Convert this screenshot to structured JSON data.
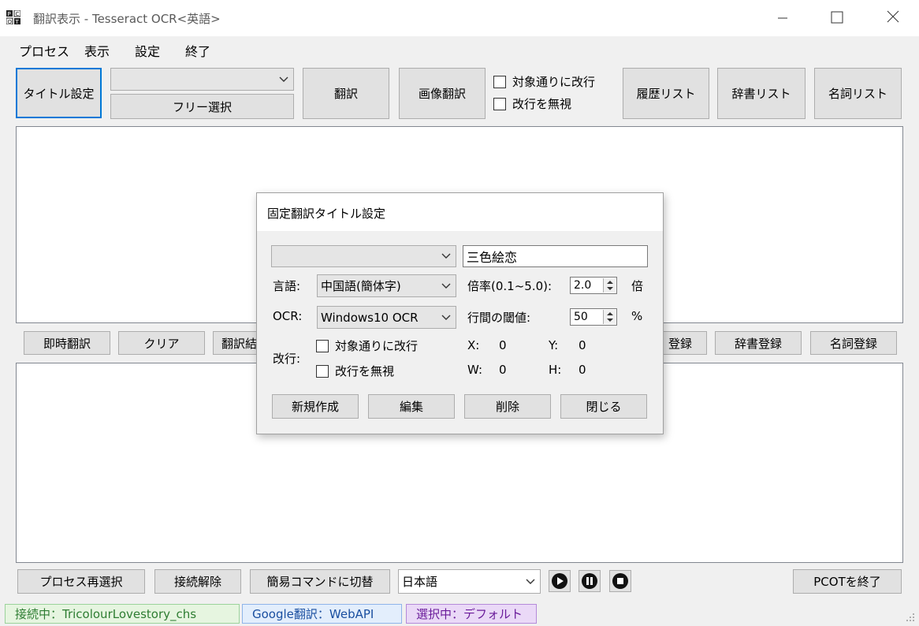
{
  "window": {
    "title": "翻訳表示 - Tesseract OCR<英語>",
    "icon": "pcot-app-icon",
    "controls": [
      "minimize-icon",
      "maximize-icon",
      "close-icon"
    ]
  },
  "menu": [
    "プロセス",
    "表示",
    "設定",
    "終了"
  ],
  "toolbar": {
    "title_setting": "タイトル設定",
    "combo_value": "",
    "free_select": "フリー選択",
    "translate": "翻訳",
    "image_translate": "画像翻訳",
    "check_linebreak_target": "対象通りに改行",
    "check_ignore_linebreak": "改行を無視",
    "history_list": "履歴リスト",
    "dict_list": "辞書リスト",
    "noun_list": "名詞リスト"
  },
  "actions": {
    "instant_translate": "即時翻訳",
    "clear": "クリア",
    "translate_partial": "翻訳結",
    "register_partial": "登録",
    "dict_register": "辞書登録",
    "noun_register": "名詞登録"
  },
  "dialog": {
    "title": "固定翻訳タイトル設定",
    "preset_combo_value": "",
    "title_text": "三色絵恋",
    "language_label": "言語:",
    "language_value": "中国語(簡体字)",
    "scale_label": "倍率(0.1~5.0):",
    "scale_value": "2.0",
    "scale_unit": "倍",
    "ocr_label": "OCR:",
    "ocr_value": "Windows10 OCR",
    "line_threshold_label": "行間の閾値:",
    "line_threshold_value": "50",
    "line_threshold_unit": "%",
    "linebreak_label": "改行:",
    "check_linebreak_target": "対象通りに改行",
    "check_ignore_linebreak": "改行を無視",
    "x_label": "X:",
    "x_value": "0",
    "y_label": "Y:",
    "y_value": "0",
    "w_label": "W:",
    "w_value": "0",
    "h_label": "H:",
    "h_value": "0",
    "new": "新規作成",
    "edit": "編集",
    "delete": "削除",
    "close": "閉じる"
  },
  "bottom": {
    "reselect_process": "プロセス再選択",
    "disconnect": "接続解除",
    "simple_command": "簡易コマンドに切替",
    "language_value": "日本語",
    "media": [
      "play-icon",
      "pause-icon",
      "stop-icon"
    ],
    "exit_pcot": "PCOTを終了"
  },
  "status": {
    "connected": "接続中：TricolourLovestory_chs",
    "engine": "Google翻訳：WebAPI",
    "selected": "選択中：デフォルト",
    "colors": {
      "connected_bg": "#e6f5e0",
      "connected_border": "#9bd39b",
      "connected_text": "#2e7d32",
      "engine_bg": "#e3eefc",
      "engine_border": "#8fb4ea",
      "engine_text": "#1a4fa0",
      "selected_bg": "#ead9f7",
      "selected_border": "#b48ad9",
      "selected_text": "#6a1b9a"
    }
  }
}
